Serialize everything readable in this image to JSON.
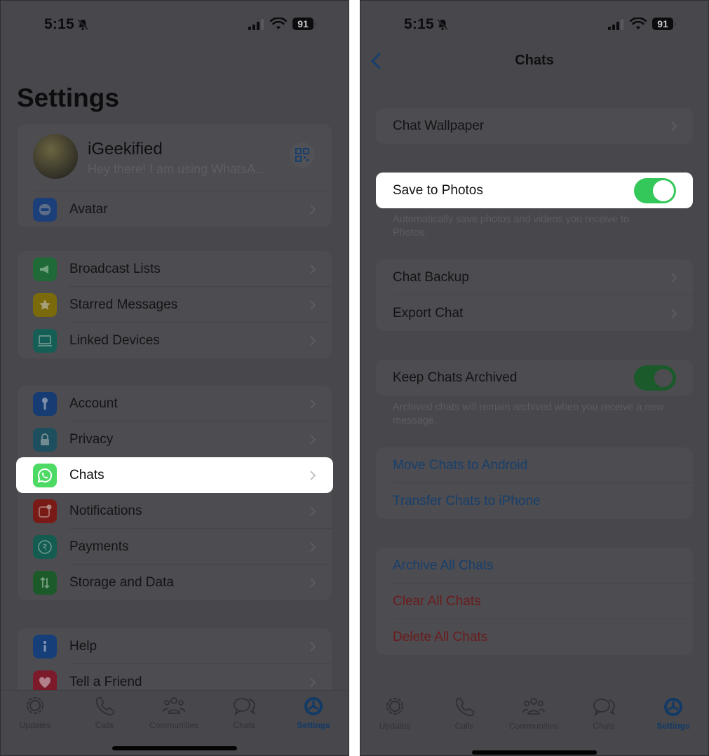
{
  "left": {
    "status_bar": {
      "time": "5:15",
      "battery": "91",
      "icons": [
        "bell-slash-icon",
        "signal-icon",
        "wifi-icon",
        "battery-icon"
      ]
    },
    "title": "Settings",
    "profile": {
      "name": "iGeekified",
      "status": "Hey there! I am using WhatsA...",
      "qr_icon": "qr-code-icon"
    },
    "groups": [
      {
        "items": [
          {
            "label": "Avatar",
            "icon": "avatar-icon",
            "color": "#1b3f78"
          }
        ]
      },
      {
        "items": [
          {
            "label": "Broadcast Lists",
            "icon": "megaphone-icon",
            "color": "#1f6a36"
          },
          {
            "label": "Starred Messages",
            "icon": "star-icon",
            "color": "#7a6a0c"
          },
          {
            "label": "Linked Devices",
            "icon": "laptop-icon",
            "color": "#145e55"
          }
        ]
      },
      {
        "items": [
          {
            "label": "Account",
            "icon": "key-icon",
            "color": "#163c73"
          },
          {
            "label": "Privacy",
            "icon": "lock-icon",
            "color": "#1d4f5e"
          },
          {
            "label": "Chats",
            "icon": "whatsapp-icon",
            "color": "#4cd964",
            "highlighted": true
          },
          {
            "label": "Notifications",
            "icon": "notification-icon",
            "color": "#7a1a16"
          },
          {
            "label": "Payments",
            "icon": "rupee-icon",
            "color": "#155c50"
          },
          {
            "label": "Storage and Data",
            "icon": "arrows-updown-icon",
            "color": "#1c5a2a"
          }
        ]
      },
      {
        "items": [
          {
            "label": "Help",
            "icon": "info-icon",
            "color": "#163f7a"
          },
          {
            "label": "Tell a Friend",
            "icon": "heart-icon",
            "color": "#7c1a2a"
          }
        ]
      }
    ],
    "tabs": [
      {
        "label": "Updates",
        "icon": "updates-icon"
      },
      {
        "label": "Calls",
        "icon": "phone-icon"
      },
      {
        "label": "Communities",
        "icon": "communities-icon"
      },
      {
        "label": "Chats",
        "icon": "chats-icon"
      },
      {
        "label": "Settings",
        "icon": "settings-gear-icon",
        "active": true
      }
    ]
  },
  "right": {
    "status_bar": {
      "time": "5:15",
      "battery": "91"
    },
    "nav": {
      "title": "Chats",
      "back_icon": "chevron-left-icon"
    },
    "chat_wallpaper": "Chat Wallpaper",
    "save_to_photos": {
      "label": "Save to Photos",
      "enabled": true,
      "footnote": "Automatically save photos and videos you receive to Photos."
    },
    "backup_group": [
      "Chat Backup",
      "Export Chat"
    ],
    "keep_archived": {
      "label": "Keep Chats Archived",
      "enabled": true,
      "footnote": "Archived chats will remain archived when you receive a new message."
    },
    "transfer_group": [
      "Move Chats to Android",
      "Transfer Chats to iPhone"
    ],
    "actions_group": [
      {
        "label": "Archive All Chats",
        "style": "blue"
      },
      {
        "label": "Clear All Chats",
        "style": "red"
      },
      {
        "label": "Delete All Chats",
        "style": "red"
      }
    ],
    "tabs": [
      {
        "label": "Updates"
      },
      {
        "label": "Calls"
      },
      {
        "label": "Communities"
      },
      {
        "label": "Chats"
      },
      {
        "label": "Settings",
        "active": true
      }
    ]
  },
  "colors": {
    "accent_green": "#34c759",
    "active_tab": "#123a66",
    "dim_overlay_bg": "#48474c"
  }
}
